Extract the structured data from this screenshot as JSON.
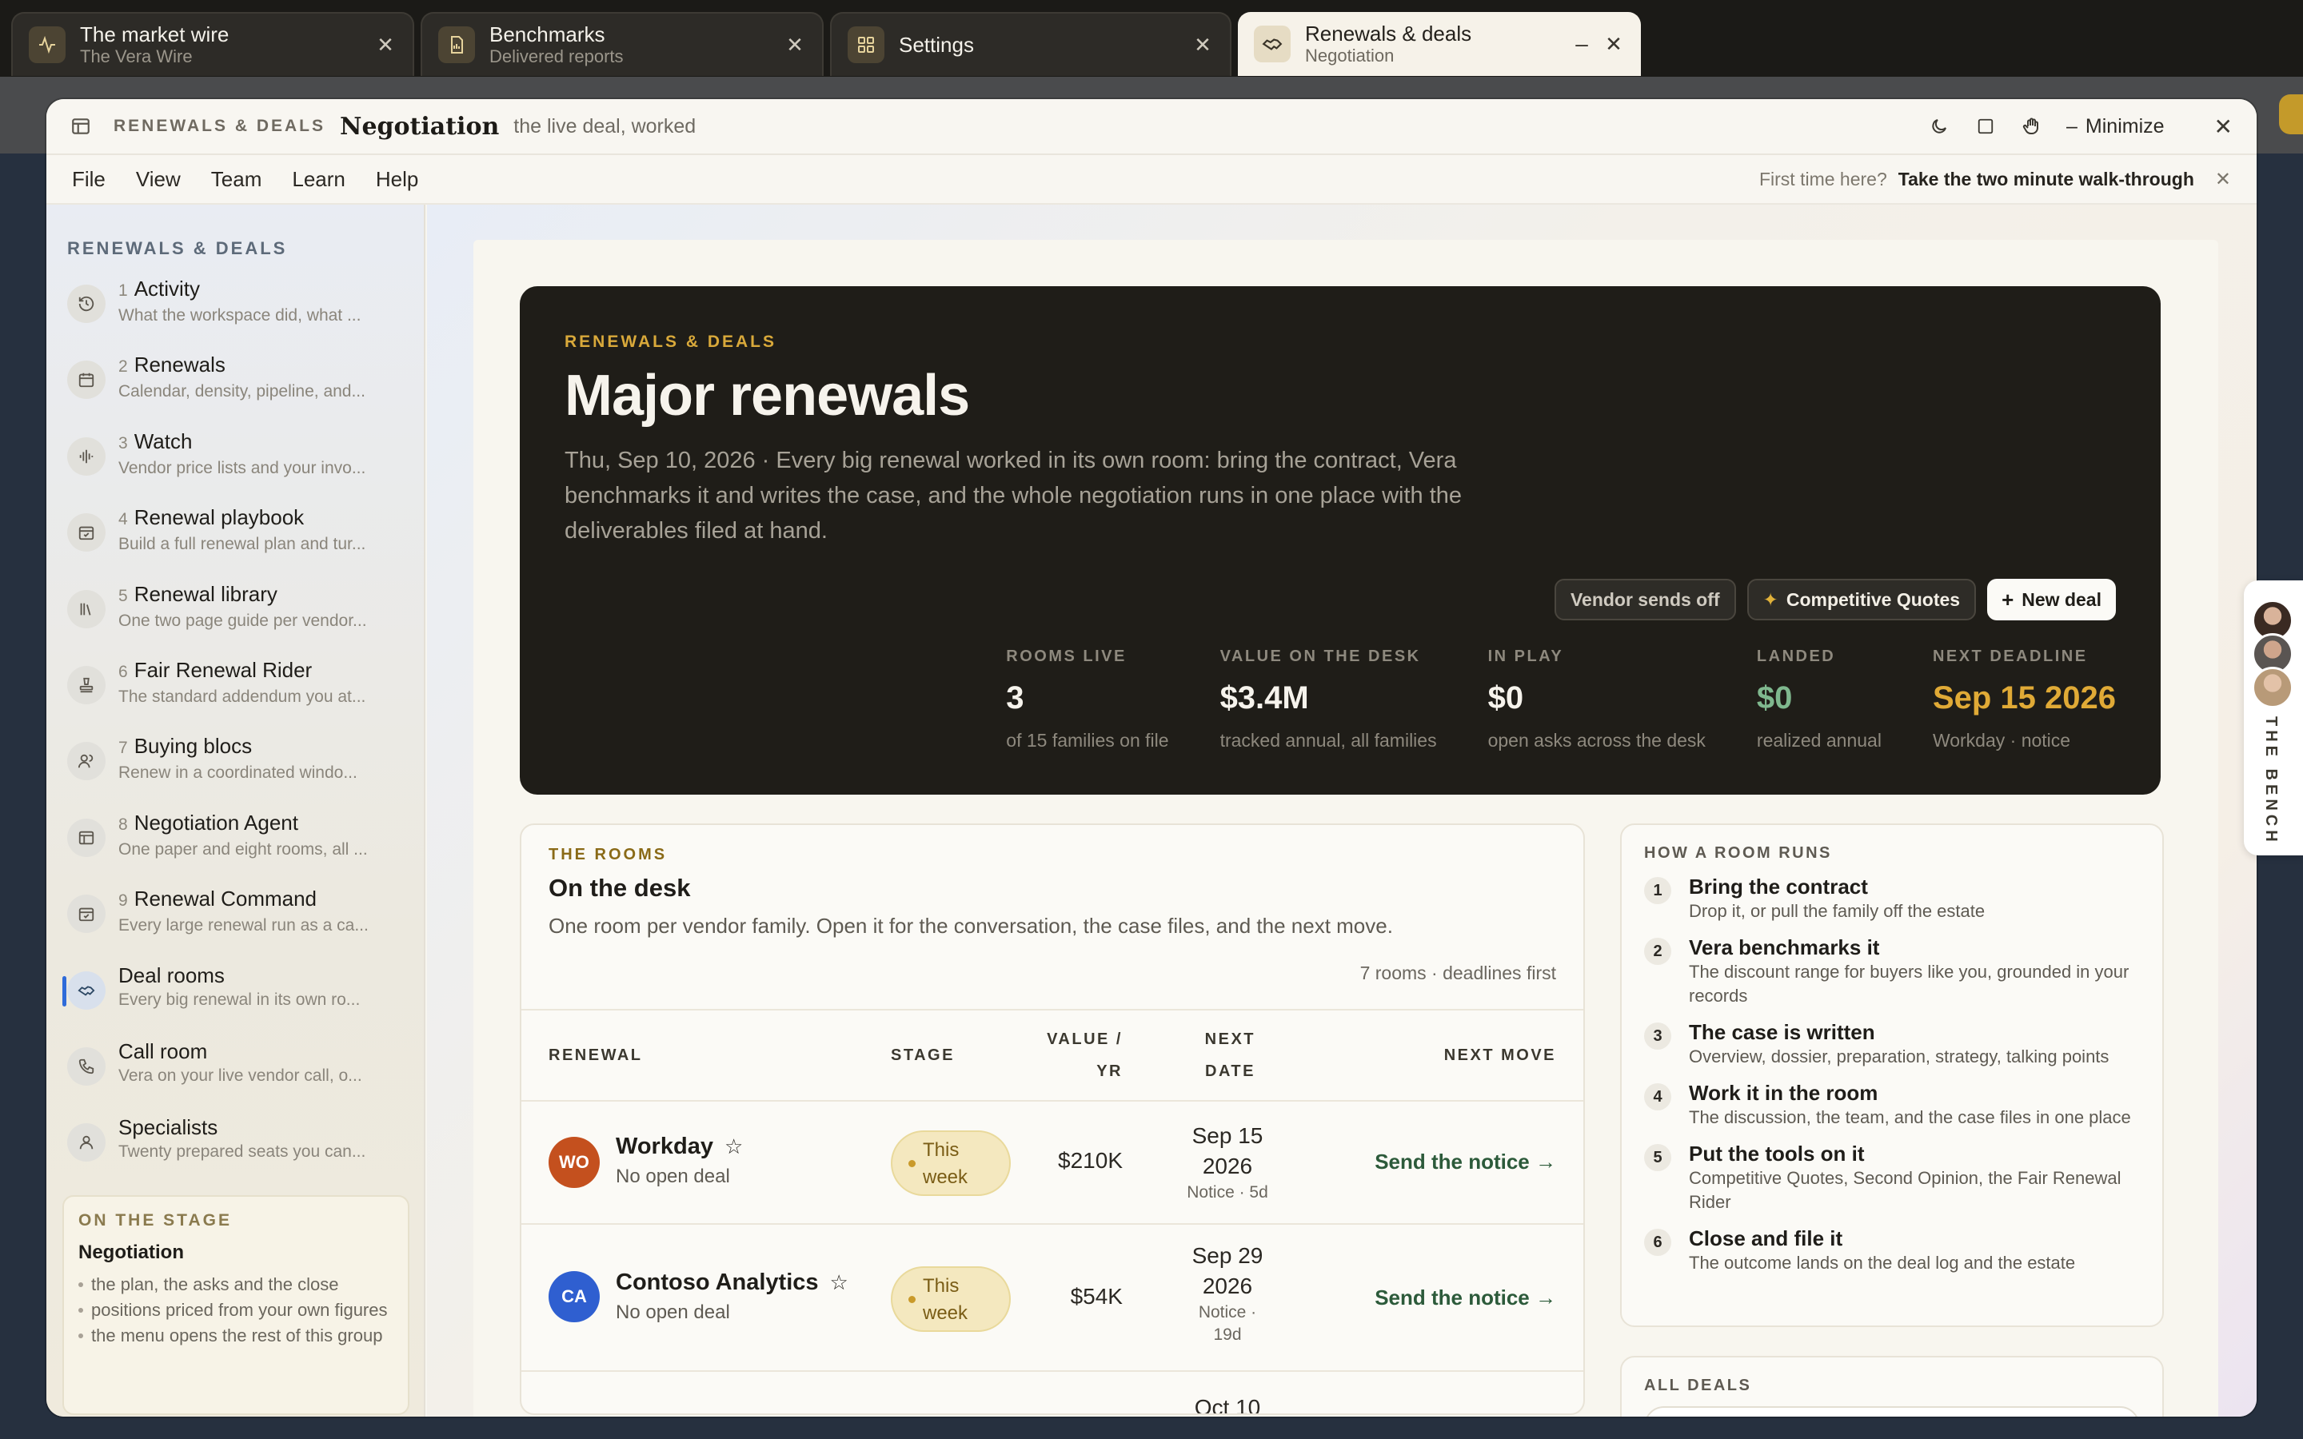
{
  "tabs": [
    {
      "title": "The market wire",
      "subtitle": "The Vera Wire",
      "icon": "pulse-icon"
    },
    {
      "title": "Benchmarks",
      "subtitle": "Delivered reports",
      "icon": "report-icon"
    },
    {
      "title": "Settings",
      "subtitle": "",
      "icon": "grid-icon"
    },
    {
      "title": "Renewals & deals",
      "subtitle": "Negotiation",
      "icon": "handshake-icon"
    }
  ],
  "window": {
    "eyebrow": "RENEWALS & DEALS",
    "title": "Negotiation",
    "subtitle": "the live deal, worked",
    "minimize_label": "Minimize"
  },
  "menu": [
    "File",
    "View",
    "Team",
    "Learn",
    "Help"
  ],
  "walkthrough": {
    "question": "First time here?",
    "action": "Take the two minute walk-through"
  },
  "sidebar": {
    "heading": "RENEWALS & DEALS",
    "items": [
      {
        "num": "1",
        "title": "Activity",
        "desc": "What the workspace did, what ..."
      },
      {
        "num": "2",
        "title": "Renewals",
        "desc": "Calendar, density, pipeline, and..."
      },
      {
        "num": "3",
        "title": "Watch",
        "desc": "Vendor price lists and your invo..."
      },
      {
        "num": "4",
        "title": "Renewal playbook",
        "desc": "Build a full renewal plan and tur..."
      },
      {
        "num": "5",
        "title": "Renewal library",
        "desc": "One two page guide per vendor..."
      },
      {
        "num": "6",
        "title": "Fair Renewal Rider",
        "desc": "The standard addendum you at..."
      },
      {
        "num": "7",
        "title": "Buying blocs",
        "desc": "Renew in a coordinated windo..."
      },
      {
        "num": "8",
        "title": "Negotiation Agent",
        "desc": "One paper and eight rooms, all ..."
      },
      {
        "num": "9",
        "title": "Renewal Command",
        "desc": "Every large renewal run as a ca..."
      },
      {
        "num": "",
        "title": "Deal rooms",
        "desc": "Every big renewal in its own ro..."
      },
      {
        "num": "",
        "title": "Call room",
        "desc": "Vera on your live vendor call, o..."
      },
      {
        "num": "",
        "title": "Specialists",
        "desc": "Twenty prepared seats you can..."
      }
    ],
    "stage": {
      "heading": "ON THE STAGE",
      "title": "Negotiation",
      "bullets": [
        "the plan, the asks and the close",
        "positions priced from your own figures",
        "the menu opens the rest of this group"
      ]
    }
  },
  "hero": {
    "eyebrow": "RENEWALS & DEALS",
    "title": "Major renewals",
    "description": "Thu, Sep 10, 2026 · Every big renewal worked in its own room: bring the contract, Vera benchmarks it and writes the case, and the whole negotiation runs in one place with the deliverables filed at hand.",
    "actions": {
      "vendor": "Vendor sends off",
      "quotes": "Competitive Quotes",
      "new_deal": "New deal"
    },
    "stats": [
      {
        "label": "ROOMS LIVE",
        "value": "3",
        "sub": "of 15 families on file"
      },
      {
        "label": "VALUE ON THE DESK",
        "value": "$3.4M",
        "sub": "tracked annual, all families"
      },
      {
        "label": "IN PLAY",
        "value": "$0",
        "sub": "open asks across the desk"
      },
      {
        "label": "LANDED",
        "value": "$0",
        "sub": "realized annual"
      },
      {
        "label": "NEXT DEADLINE",
        "value": "Sep 15 2026",
        "sub": "Workday · notice"
      }
    ]
  },
  "rooms": {
    "eyebrow": "THE ROOMS",
    "title": "On the desk",
    "description": "One room per vendor family. Open it for the conversation, the case files, and the next move.",
    "count": "7 rooms · deadlines first",
    "columns": {
      "renewal": "RENEWAL",
      "stage": "STAGE",
      "value_1": "VALUE /",
      "value_2": "YR",
      "date_1": "NEXT",
      "date_2": "DATE",
      "move": "NEXT MOVE"
    },
    "rows": [
      {
        "initials": "WO",
        "name": "Workday",
        "status": "No open deal",
        "stage_1": "This",
        "stage_2": "week",
        "value": "$210K",
        "date_1": "Sep 15",
        "date_2": "2026",
        "note": "Notice · 5d",
        "move": "Send the notice →",
        "color": "#c4501e"
      },
      {
        "initials": "CA",
        "name": "Contoso Analytics",
        "status": "No open deal",
        "stage_1": "This",
        "stage_2": "week",
        "value": "$54K",
        "date_1": "Sep 29",
        "date_2": "2026",
        "note": "Notice ·",
        "note_2": "19d",
        "move": "Send the notice →",
        "color": "#2f5fd0"
      },
      {
        "date_1": "Oct 10"
      }
    ]
  },
  "how": {
    "eyebrow": "HOW A ROOM RUNS",
    "steps": [
      {
        "n": "1",
        "title": "Bring the contract",
        "desc": "Drop it, or pull the family off the estate"
      },
      {
        "n": "2",
        "title": "Vera benchmarks it",
        "desc": "The discount range for buyers like you, grounded in your records"
      },
      {
        "n": "3",
        "title": "The case is written",
        "desc": "Overview, dossier, preparation, strategy, talking points"
      },
      {
        "n": "4",
        "title": "Work it in the room",
        "desc": "The discussion, the team, and the case files in one place"
      },
      {
        "n": "5",
        "title": "Put the tools on it",
        "desc": "Competitive Quotes, Second Opinion, the Fair Renewal Rider"
      },
      {
        "n": "6",
        "title": "Close and file it",
        "desc": "The outcome lands on the deal log and the estate"
      }
    ]
  },
  "all_deals": {
    "eyebrow": "ALL DEALS"
  },
  "bench": {
    "label": "THE BENCH"
  }
}
